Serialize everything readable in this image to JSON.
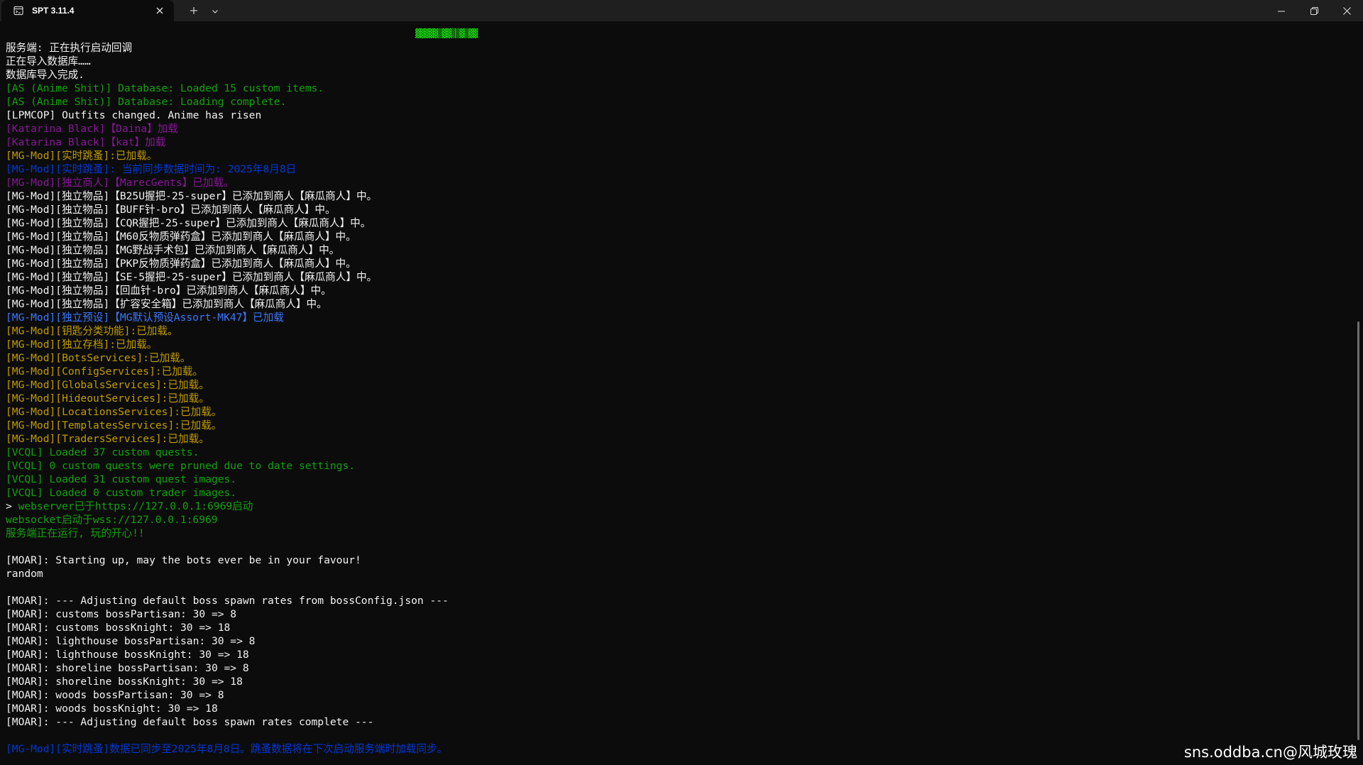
{
  "window": {
    "tab_title": "SPT 3.11.4",
    "tab_icon": "terminal-icon",
    "new_tab_icon": "plus-icon",
    "dropdown_icon": "chevron-down-icon",
    "minimize_icon": "minimize-icon",
    "restore_icon": "restore-icon",
    "close_icon": "close-icon"
  },
  "terminal": {
    "banner": "▓▓▓▓▓▒▓▓▒▒▓▒▓▓",
    "lines": [
      {
        "text": "服务端: 正在执行启动回调",
        "color": "white"
      },
      {
        "text": "正在导入数据库……",
        "color": "white"
      },
      {
        "text": "数据库导入完成.",
        "color": "white"
      },
      {
        "text": "[AS (Anime Shit)] Database: Loaded 15 custom items.",
        "color": "green"
      },
      {
        "text": "[AS (Anime Shit)] Database: Loading complete.",
        "color": "green"
      },
      {
        "text": "[LPMCOP] Outfits changed. Anime has risen",
        "color": "white"
      },
      {
        "text": "[Katarina Black]【Daina】加载",
        "color": "magenta"
      },
      {
        "text": "[Katarina Black]【kat】加载",
        "color": "magenta"
      },
      {
        "text": "[MG-Mod][实时跳蚤]:已加载。",
        "color": "yellow"
      },
      {
        "text": "[MG-Mod][实时跳蚤]: 当前同步数据时间为: 2025年8月8日",
        "color": "blue"
      },
      {
        "text": "[MG-Mod][独立商人]【MarecGents】已加载。",
        "color": "magenta"
      },
      {
        "text": "[MG-Mod][独立物品]【B25U握把-25-super】已添加到商人【麻瓜商人】中。",
        "color": "white"
      },
      {
        "text": "[MG-Mod][独立物品]【BUFF针-bro】已添加到商人【麻瓜商人】中。",
        "color": "white"
      },
      {
        "text": "[MG-Mod][独立物品]【CQR握把-25-super】已添加到商人【麻瓜商人】中。",
        "color": "white"
      },
      {
        "text": "[MG-Mod][独立物品]【M60反物质弹药盒】已添加到商人【麻瓜商人】中。",
        "color": "white"
      },
      {
        "text": "[MG-Mod][独立物品]【MG野战手术包】已添加到商人【麻瓜商人】中。",
        "color": "white"
      },
      {
        "text": "[MG-Mod][独立物品]【PKP反物质弹药盒】已添加到商人【麻瓜商人】中。",
        "color": "white"
      },
      {
        "text": "[MG-Mod][独立物品]【SE-5握把-25-super】已添加到商人【麻瓜商人】中。",
        "color": "white"
      },
      {
        "text": "[MG-Mod][独立物品]【回血针-bro】已添加到商人【麻瓜商人】中。",
        "color": "white"
      },
      {
        "text": "[MG-Mod][独立物品]【扩容安全箱】已添加到商人【麻瓜商人】中。",
        "color": "white"
      },
      {
        "text": "[MG-Mod][独立预设]【MG默认预设Assort-MK47】已加载",
        "color": "cyan"
      },
      {
        "text": "[MG-Mod][钥匙分类功能]:已加载。",
        "color": "yellow"
      },
      {
        "text": "[MG-Mod][独立存档]:已加载。",
        "color": "yellow"
      },
      {
        "text": "[MG-Mod][BotsServices]:已加载。",
        "color": "yellow"
      },
      {
        "text": "[MG-Mod][ConfigServices]:已加载。",
        "color": "yellow"
      },
      {
        "text": "[MG-Mod][GlobalsServices]:已加载。",
        "color": "yellow"
      },
      {
        "text": "[MG-Mod][HideoutServices]:已加载。",
        "color": "yellow"
      },
      {
        "text": "[MG-Mod][LocationsServices]:已加载。",
        "color": "yellow"
      },
      {
        "text": "[MG-Mod][TemplatesServices]:已加载。",
        "color": "yellow"
      },
      {
        "text": "[MG-Mod][TradersServices]:已加载。",
        "color": "yellow"
      },
      {
        "text": "[VCQL] Loaded 37 custom quests.",
        "color": "green"
      },
      {
        "text": "[VCQL] 0 custom quests were pruned due to date settings.",
        "color": "green"
      },
      {
        "text": "[VCQL] Loaded 31 custom quest images.",
        "color": "green"
      },
      {
        "text": "[VCQL] Loaded 0 custom trader images.",
        "color": "green"
      },
      {
        "text": "> webserver已于https://127.0.0.1:6969启动",
        "color": "green",
        "prompt": true
      },
      {
        "text": "websocket启动于wss://127.0.0.1:6969",
        "color": "green"
      },
      {
        "text": "服务端正在运行, 玩的开心!!",
        "color": "green"
      },
      {
        "text": "",
        "color": "white"
      },
      {
        "text": "[MOAR]: Starting up, may the bots ever be in your favour!",
        "color": "white"
      },
      {
        "text": "random",
        "color": "white"
      },
      {
        "text": "",
        "color": "white"
      },
      {
        "text": "[MOAR]: --- Adjusting default boss spawn rates from bossConfig.json ---",
        "color": "white"
      },
      {
        "text": "[MOAR]: customs bossPartisan: 30 => 8",
        "color": "white"
      },
      {
        "text": "[MOAR]: customs bossKnight: 30 => 18",
        "color": "white"
      },
      {
        "text": "[MOAR]: lighthouse bossPartisan: 30 => 8",
        "color": "white"
      },
      {
        "text": "[MOAR]: lighthouse bossKnight: 30 => 18",
        "color": "white"
      },
      {
        "text": "[MOAR]: shoreline bossPartisan: 30 => 8",
        "color": "white"
      },
      {
        "text": "[MOAR]: shoreline bossKnight: 30 => 18",
        "color": "white"
      },
      {
        "text": "[MOAR]: woods bossPartisan: 30 => 8",
        "color": "white"
      },
      {
        "text": "[MOAR]: woods bossKnight: 30 => 18",
        "color": "white"
      },
      {
        "text": "[MOAR]: --- Adjusting default boss spawn rates complete ---",
        "color": "white"
      },
      {
        "text": "",
        "color": "white"
      },
      {
        "text": "[MG-Mod][实时跳蚤]数据已同步至2025年8月8日。跳蚤数据将在下次启动服务端时加载同步。",
        "color": "blue"
      }
    ]
  },
  "colors": {
    "white": "#f2f2f2",
    "green": "#13a10e",
    "magenta": "#881798",
    "yellow": "#c19c00",
    "blue": "#0037da",
    "cyan": "#3b78ff"
  },
  "watermark": "sns.oddba.cn@风城玫瑰"
}
